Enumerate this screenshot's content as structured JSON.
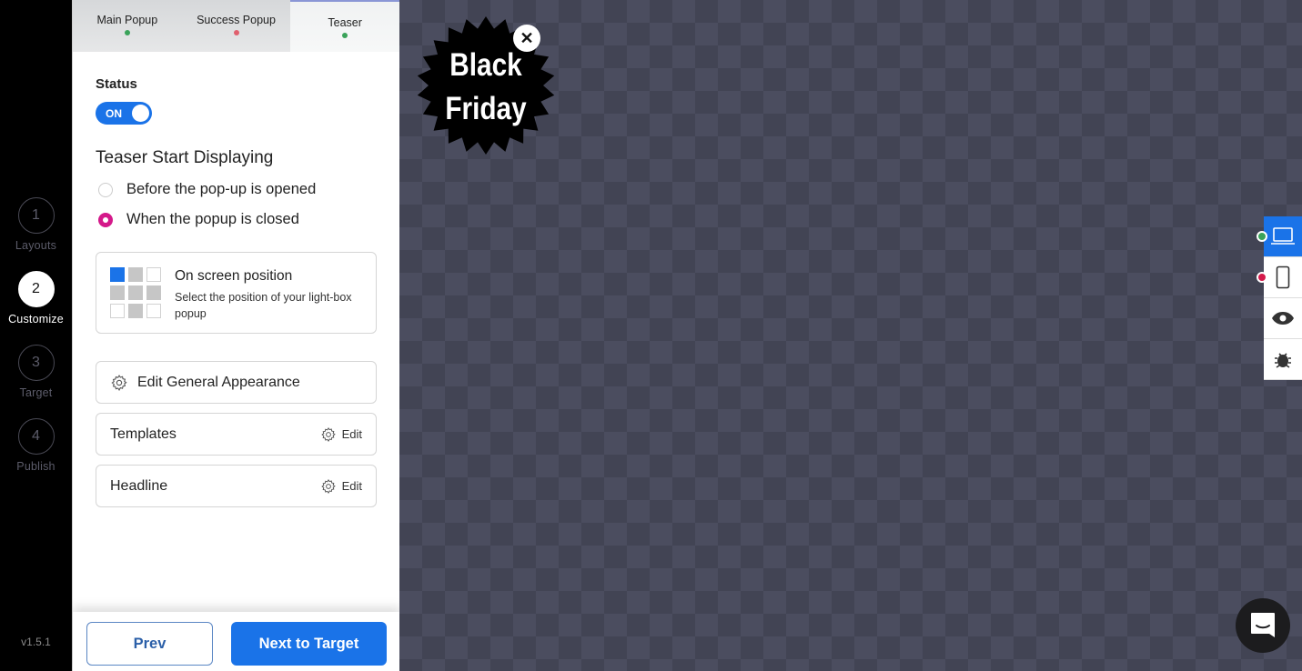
{
  "steps": [
    {
      "number": "1",
      "label": "Layouts",
      "active": false
    },
    {
      "number": "2",
      "label": "Customize",
      "active": true
    },
    {
      "number": "3",
      "label": "Target",
      "active": false
    },
    {
      "number": "4",
      "label": "Publish",
      "active": false
    }
  ],
  "version": "v1.5.1",
  "tabs": [
    {
      "label": "Main Popup",
      "dot_color": "#3aa35a",
      "active": false
    },
    {
      "label": "Success Popup",
      "dot_color": "#e0606e",
      "active": false
    },
    {
      "label": "Teaser",
      "dot_color": "#3aa35a",
      "active": true
    }
  ],
  "status": {
    "label": "Status",
    "toggle_text": "ON",
    "on": true
  },
  "teaser_start": {
    "title": "Teaser Start Displaying",
    "options": [
      {
        "label": "Before the pop-up is opened",
        "checked": false
      },
      {
        "label": "When the popup is closed",
        "checked": true
      }
    ]
  },
  "position": {
    "title": "On screen position",
    "description": "Select the position of your light-box popup",
    "grid": [
      "selected",
      "filled",
      "empty",
      "filled",
      "filled",
      "filled",
      "empty",
      "filled",
      "empty"
    ]
  },
  "appearance": {
    "label": "Edit General Appearance"
  },
  "rows": [
    {
      "label": "Templates",
      "edit_label": "Edit"
    },
    {
      "label": "Headline",
      "edit_label": "Edit"
    }
  ],
  "footer": {
    "prev_label": "Prev",
    "next_label": "Next to Target"
  },
  "teaser_preview": {
    "line1": "Black",
    "line2": "Friday",
    "close_symbol": "✕"
  },
  "device_tools": [
    {
      "name": "desktop",
      "active": true,
      "dot_color": "#3aa35a"
    },
    {
      "name": "mobile",
      "active": false,
      "dot_color": "#d4194a"
    },
    {
      "name": "preview",
      "active": false
    },
    {
      "name": "debug",
      "active": false
    }
  ],
  "colors": {
    "accent": "#1a73e8",
    "radio": "#d4198a"
  }
}
